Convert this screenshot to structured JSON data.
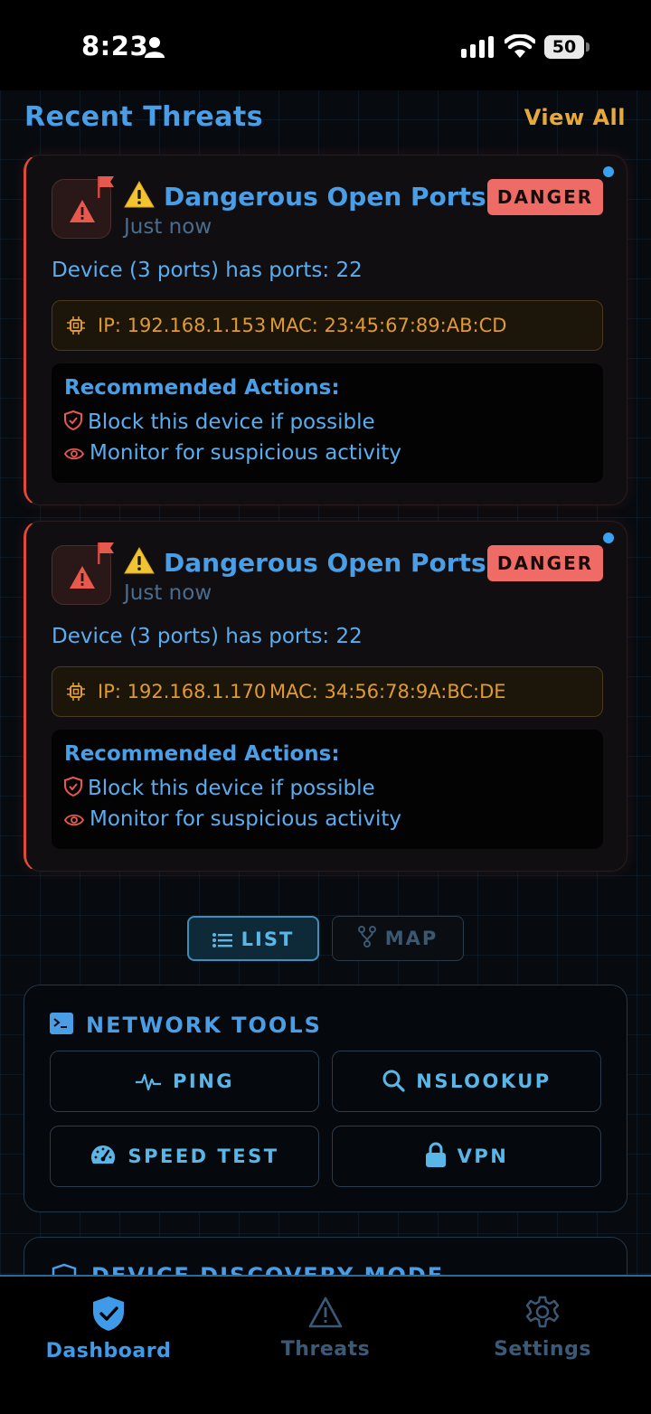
{
  "status_bar": {
    "time": "8:23",
    "battery": "50"
  },
  "header": {
    "title": "Recent Threats",
    "view_all": "View All"
  },
  "threats": [
    {
      "title": "Dangerous Open Ports",
      "time": "Just now",
      "badge": "DANGER",
      "description": "Device (3 ports) has ports: 22",
      "ip": "IP: 192.168.1.153",
      "mac": "MAC: 23:45:67:89:AB:CD",
      "actions_title": "Recommended Actions:",
      "actions": [
        "Block this device if possible",
        "Monitor for suspicious activity"
      ]
    },
    {
      "title": "Dangerous Open Ports",
      "time": "Just now",
      "badge": "DANGER",
      "description": "Device (3 ports) has ports: 22",
      "ip": "IP: 192.168.1.170",
      "mac": "MAC: 34:56:78:9A:BC:DE",
      "actions_title": "Recommended Actions:",
      "actions": [
        "Block this device if possible",
        "Monitor for suspicious activity"
      ]
    }
  ],
  "view_toggle": {
    "list": "LIST",
    "map": "MAP",
    "selected": "LIST"
  },
  "network_tools": {
    "title": "NETWORK TOOLS",
    "buttons": [
      {
        "label": "PING",
        "icon": "heartbeat-icon"
      },
      {
        "label": "NSLOOKUP",
        "icon": "search-icon"
      },
      {
        "label": "SPEED TEST",
        "icon": "speedometer-icon"
      },
      {
        "label": "VPN",
        "icon": "lock-icon"
      }
    ]
  },
  "discovery": {
    "title": "DEVICE DISCOVERY MODE"
  },
  "bottom_nav": {
    "items": [
      {
        "label": "Dashboard",
        "icon": "shield-check-icon",
        "active": true
      },
      {
        "label": "Threats",
        "icon": "warning-icon",
        "active": false
      },
      {
        "label": "Settings",
        "icon": "gear-icon",
        "active": false
      }
    ]
  },
  "colors": {
    "accent_blue": "#4a9ee6",
    "danger_red": "#ee6b66",
    "warning_amber": "#e8a93c",
    "background": "#070b10"
  }
}
